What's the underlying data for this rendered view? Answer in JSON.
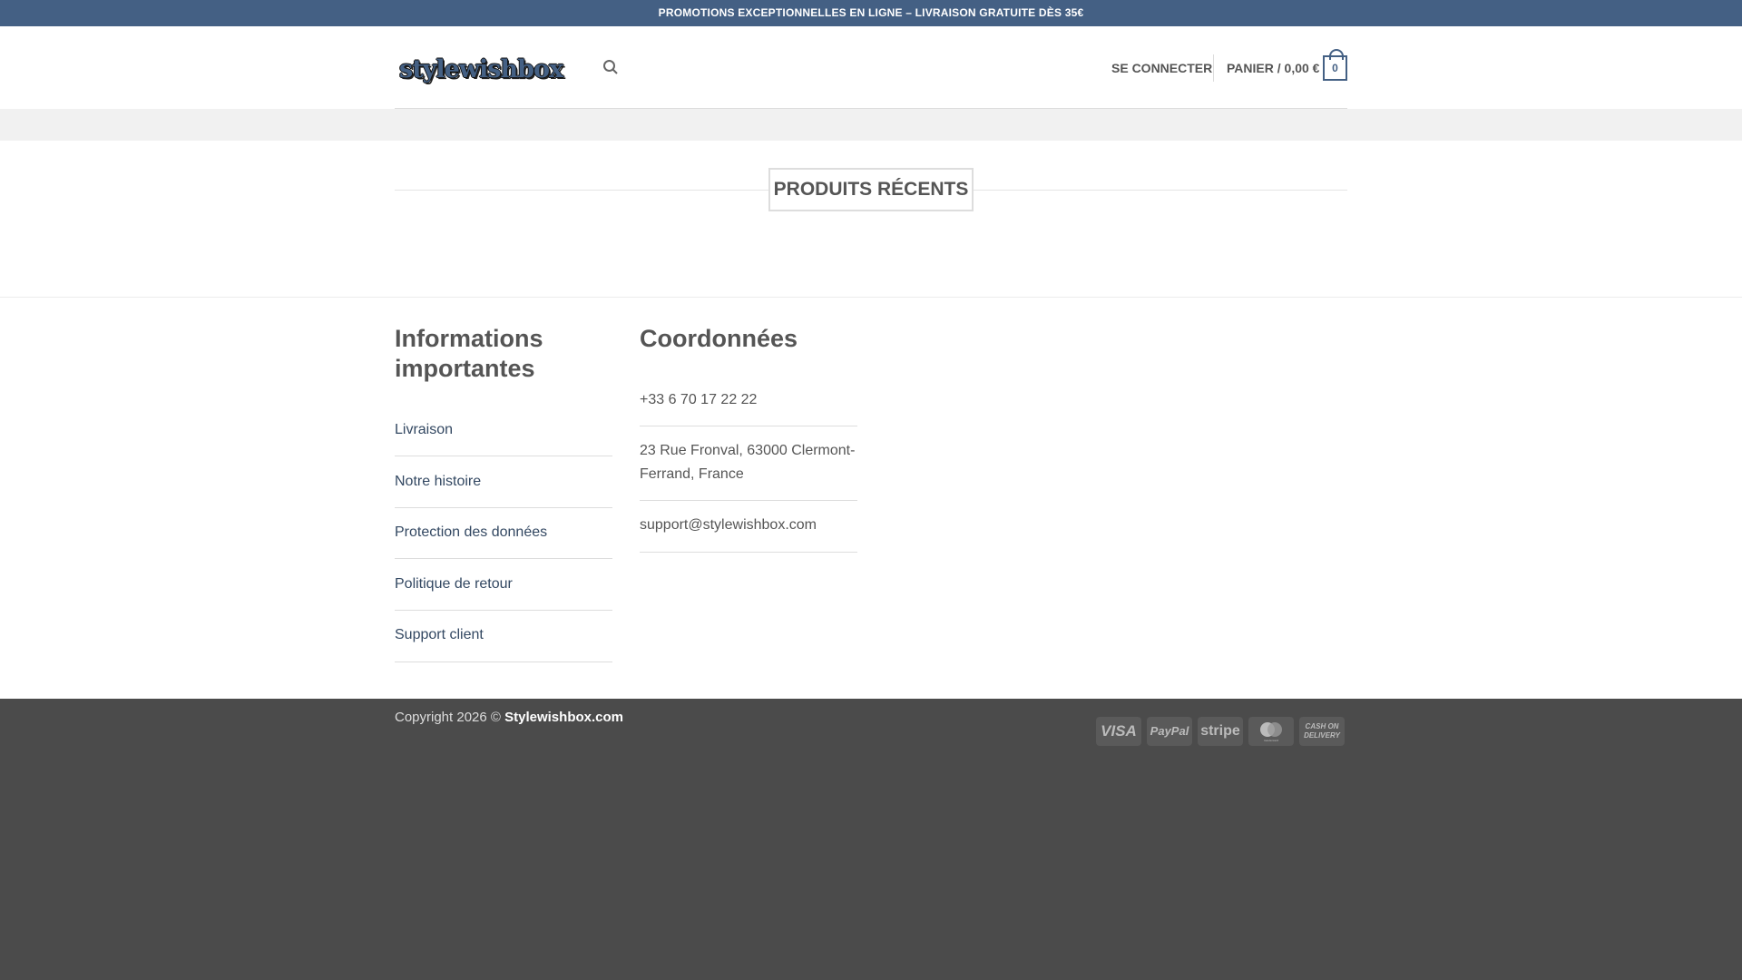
{
  "topbar": {
    "text": "PROMOTIONS EXCEPTIONNELLES EN LIGNE – LIVRAISON GRATUITE DÈS 35€"
  },
  "header": {
    "logo": "stylewishbox",
    "login": "SE CONNECTER",
    "cart": "PANIER / 0,00 €",
    "cart_count": "0"
  },
  "section": {
    "title": "PRODUITS RÉCENTS"
  },
  "footer": {
    "info_title": "Informations importantes",
    "links": [
      "Livraison",
      "Notre histoire",
      "Protection des données",
      "Politique de retour",
      "Support client"
    ],
    "contact_title": "Coordonnées",
    "phone": "+33 6 70 17 22 22",
    "address": "23 Rue Fronval, 63000 Clermont-Ferrand, France",
    "email": "support@stylewishbox.com",
    "copyright": "Copyright 2026 ©",
    "brand": "Stylewishbox.com",
    "payments": [
      "VISA",
      "PayPal",
      "stripe",
      "mastercard",
      "CASH ON DELIVERY"
    ]
  }
}
